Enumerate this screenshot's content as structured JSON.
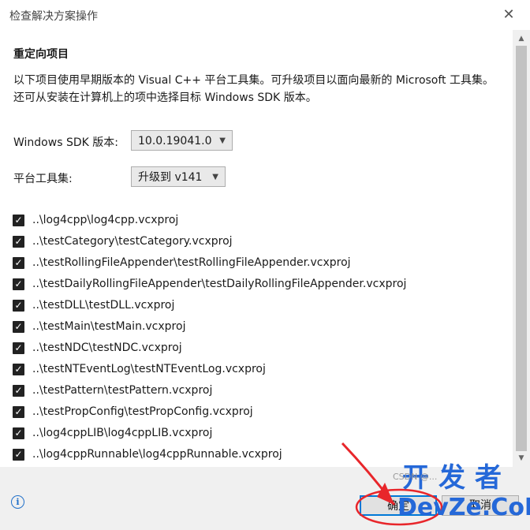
{
  "window": {
    "title": "检查解决方案操作",
    "close_glyph": "✕"
  },
  "section": {
    "heading": "重定向项目",
    "description": "以下项目使用早期版本的 Visual C++ 平台工具集。可升级项目以面向最新的 Microsoft 工具集。还可从安装在计算机上的项中选择目标 Windows SDK 版本。"
  },
  "sdk": {
    "label": "Windows SDK 版本:",
    "value": "10.0.19041.0"
  },
  "toolset": {
    "label": "平台工具集:",
    "value": "升级到 v141"
  },
  "projects": [
    {
      "path": "..\\log4cpp\\log4cpp.vcxproj",
      "checked": true
    },
    {
      "path": "..\\testCategory\\testCategory.vcxproj",
      "checked": true
    },
    {
      "path": "..\\testRollingFileAppender\\testRollingFileAppender.vcxproj",
      "checked": true
    },
    {
      "path": "..\\testDailyRollingFileAppender\\testDailyRollingFileAppender.vcxproj",
      "checked": true
    },
    {
      "path": "..\\testDLL\\testDLL.vcxproj",
      "checked": true
    },
    {
      "path": "..\\testMain\\testMain.vcxproj",
      "checked": true
    },
    {
      "path": "..\\testNDC\\testNDC.vcxproj",
      "checked": true
    },
    {
      "path": "..\\testNTEventLog\\testNTEventLog.vcxproj",
      "checked": true
    },
    {
      "path": "..\\testPattern\\testPattern.vcxproj",
      "checked": true
    },
    {
      "path": "..\\testPropConfig\\testPropConfig.vcxproj",
      "checked": true
    },
    {
      "path": "..\\log4cppLIB\\log4cppLIB.vcxproj",
      "checked": true
    },
    {
      "path": "..\\log4cppRunnable\\log4cppRunnable.vcxproj",
      "checked": true
    }
  ],
  "buttons": {
    "ok": "确定",
    "cancel": "取消"
  },
  "watermark": {
    "top": "开发者",
    "small": "CSDN @...",
    "bottom": "DevZe.CoM"
  },
  "colors": {
    "accent": "#0078d7",
    "annotation": "#e8262b",
    "watermark": "#2568d8"
  }
}
